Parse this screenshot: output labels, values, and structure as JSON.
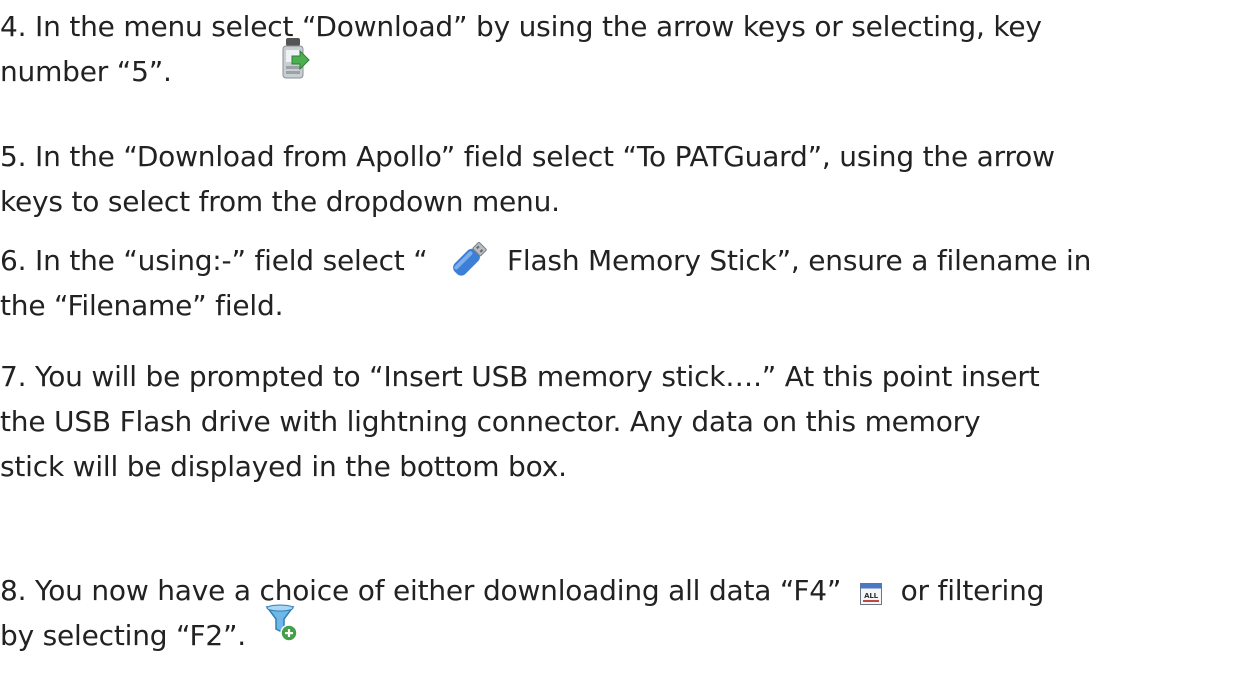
{
  "steps": [
    {
      "lines": [
        "4. In the menu select “Download” by using the arrow keys or selecting, key",
        "number “5”."
      ],
      "icon": "download-app-icon"
    },
    {
      "lines": [
        "5. In the “Download from Apollo” field select “To PATGuard”, using the arrow",
        "keys to select from the dropdown menu."
      ]
    },
    {
      "line1_before": "6. In the “using:-” field select “",
      "line1_after": "Flash Memory Stick”, ensure a filename in",
      "line2": "the “Filename” field.",
      "icon": "usb-stick-icon"
    },
    {
      "lines": [
        "7. You will be prompted to “Insert USB memory stick….” At this point insert",
        "the USB Flash drive with lightning connector. Any data on this memory",
        "stick will be displayed in the bottom box."
      ]
    },
    {
      "line1_before": "8. You now have a choice of either downloading all data “F4”",
      "line1_after": "or filtering",
      "line2": "by selecting “F2”.",
      "icon_all_label": "ALL",
      "icons": [
        "all-data-icon",
        "filter-add-icon"
      ]
    }
  ]
}
